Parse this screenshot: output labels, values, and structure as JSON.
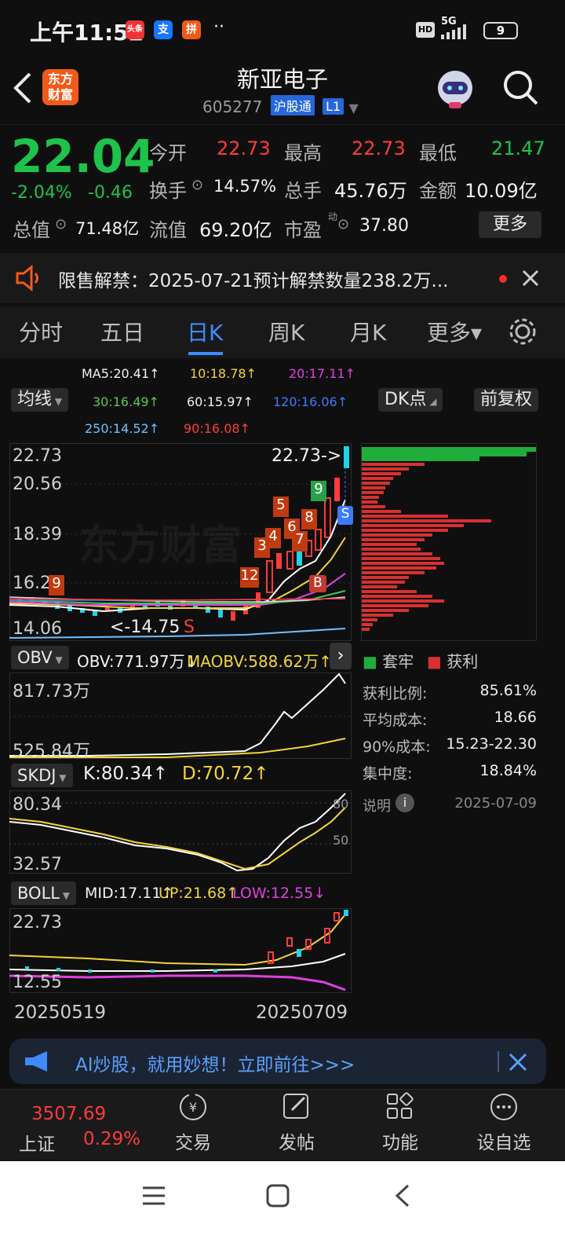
{
  "status_bar": {
    "time": "上午11:52",
    "apps": [
      "头条",
      "支",
      "拼"
    ],
    "dots": "··",
    "hd": "HD",
    "network": "5G",
    "battery": "9"
  },
  "header": {
    "logo_line1": "东方",
    "logo_line2": "财富",
    "stock_name": "新亚电子",
    "stock_code": "605277",
    "market_tag": "沪股通",
    "level_tag": "L1"
  },
  "quote": {
    "price": "22.04",
    "change_pct": "-2.04%",
    "change_amt": "-0.46",
    "open_label": "今开",
    "open": "22.73",
    "high_label": "最高",
    "high": "22.73",
    "low_label": "最低",
    "low": "21.47",
    "turnover_label": "换手",
    "turnover": "14.57%",
    "volume_label": "总手",
    "volume": "45.76万",
    "amount_label": "金额",
    "amount": "10.09亿",
    "mktcap_label": "总值",
    "mktcap": "71.48亿",
    "float_label": "流值",
    "float": "69.20亿",
    "pe_label": "市盈",
    "pe_sup": "动",
    "pe": "37.80",
    "more_button": "更多"
  },
  "notice": {
    "text": "限售解禁：2025-07-21预计解禁数量238.2万..."
  },
  "tabs": [
    {
      "label": "分时",
      "active": false
    },
    {
      "label": "五日",
      "active": false
    },
    {
      "label": "日K",
      "active": true
    },
    {
      "label": "周K",
      "active": false
    },
    {
      "label": "月K",
      "active": false
    },
    {
      "label": "更多▾",
      "active": false
    }
  ],
  "ma_legend": {
    "ma5": "MA5:20.41↑",
    "ma10": "10:18.78↑",
    "ma20": "20:17.11↑",
    "ma30": "30:16.49↑",
    "ma60": "60:15.97↑",
    "ma120": "120:16.06↑",
    "ma250": "250:14.52↑",
    "ma90": "90:16.08↑",
    "avg_button": "均线",
    "dk_button": "DK点",
    "adj_button": "前复权"
  },
  "kline": {
    "y_labels": [
      "22.73",
      "20.56",
      "18.39",
      "16.23",
      "14.06"
    ],
    "high_marker": "22.73->",
    "low_marker": "<-14.75",
    "watermark": "东方财富",
    "markers": [
      "5",
      "4",
      "3",
      "6",
      "7",
      "8",
      "9",
      "12",
      "9",
      "S",
      "B",
      "S"
    ]
  },
  "chip_panel": {
    "legend_trapped": "套牢",
    "legend_profit": "获利",
    "rows": [
      {
        "label": "获利比例:",
        "value": "85.61%"
      },
      {
        "label": "平均成本:",
        "value": "18.66"
      },
      {
        "label": "90%成本:",
        "value": "15.23-22.30"
      },
      {
        "label": "集中度:",
        "value": "18.84%"
      }
    ],
    "note_label": "说明",
    "date": "2025-07-09"
  },
  "obv": {
    "name": "OBV",
    "value": "OBV:771.97万↓",
    "ma_value": "MAOBV:588.62万↑",
    "y_top": "817.73万",
    "y_bottom": "525.84万"
  },
  "skdj": {
    "name": "SKDJ",
    "k": "K:80.34↑",
    "d": "D:70.72↑",
    "y_top": "80.34",
    "y_bottom": "32.57",
    "ref80": "80",
    "ref50": "50"
  },
  "boll": {
    "name": "BOLL",
    "mid": "MID:17.11↑",
    "up": "UP:21.68↑",
    "low": "LOW:12.55↓",
    "y_top": "22.73",
    "y_bottom": "12.55"
  },
  "dates": {
    "start": "20250519",
    "end": "20250709"
  },
  "banner": {
    "text": "AI炒股，就用妙想！立即前往>>>"
  },
  "bottom_bar": {
    "index_value": "3507.69",
    "index_name": "上证",
    "index_change": "0.29%",
    "items": [
      {
        "label": "交易",
        "icon": "yen-icon"
      },
      {
        "label": "发帖",
        "icon": "edit-icon"
      },
      {
        "label": "功能",
        "icon": "grid-icon"
      },
      {
        "label": "设自选",
        "icon": "dots-icon"
      }
    ]
  }
}
